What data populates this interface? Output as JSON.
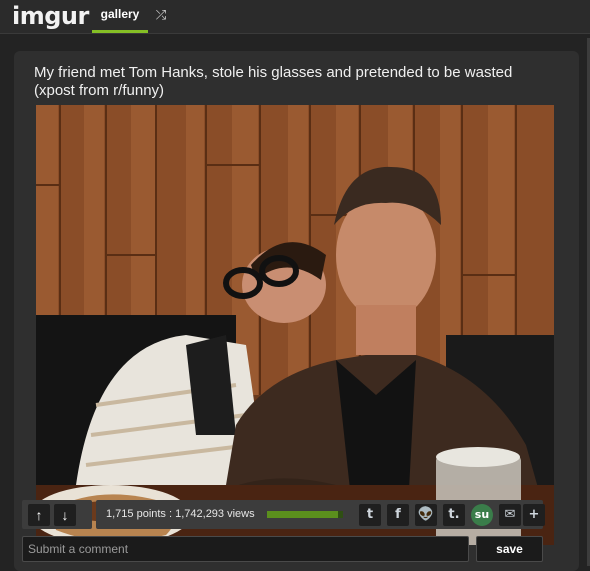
{
  "header": {
    "logo": "imgur",
    "nav_gallery": "gallery",
    "random_icon": "shuffle-icon"
  },
  "post": {
    "title": "My friend met Tom Hanks, stole his glasses and pretended to be wasted (xpost from r/funny)",
    "image_icon": "photo"
  },
  "actions": {
    "upvote_icon": "arrow-up-icon",
    "downvote_icon": "arrow-down-icon",
    "points": "1,715 points",
    "separator": " : ",
    "views": "1,742,293 views",
    "vote_ratio": 0.93,
    "share": [
      {
        "name": "twitter",
        "glyph": "t"
      },
      {
        "name": "facebook",
        "glyph": "f"
      },
      {
        "name": "reddit",
        "glyph": "👽"
      },
      {
        "name": "tumblr",
        "glyph": "t."
      },
      {
        "name": "stumbleupon",
        "glyph": "su"
      },
      {
        "name": "email",
        "glyph": "✉"
      },
      {
        "name": "more",
        "glyph": "+"
      }
    ]
  },
  "comment": {
    "placeholder": "Submit a comment",
    "save_label": "save"
  },
  "colors": {
    "accent": "#85bf25",
    "background": "#232323",
    "panel": "#2f2f2f"
  }
}
